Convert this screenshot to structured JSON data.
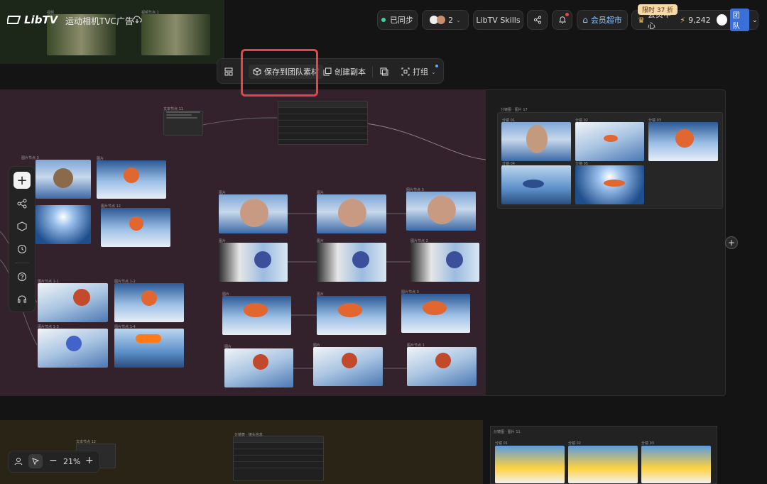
{
  "header": {
    "logo_text": "LibTV",
    "project_title": "运动相机TVC广告",
    "sync_status": "已同步",
    "collaborator_count": "2",
    "skills_label": "LibTV Skills",
    "member_market_label": "会员超市",
    "promo_badge": "限时 37 折",
    "member_center_label": "会员中心",
    "credits": "9,242",
    "team_label": "团队"
  },
  "toolbar": {
    "save_to_team_label": "保存到团队素材",
    "duplicate_label": "创建副本",
    "group_label": "打组"
  },
  "canvas": {
    "top_labels": [
      "视频",
      "视频节点 1"
    ],
    "right_panel_title": "分镜图 · 图片 17",
    "right_panel_items": [
      "分镜 01",
      "分镜 02",
      "分镜 03",
      "分镜 04",
      "分镜 05"
    ],
    "left_labels": [
      "图片节点 3",
      "图片",
      "图片节点 12",
      "图片节点 1-1",
      "图片节点 1-2",
      "图片节点 1-3",
      "图片节点 1-4"
    ],
    "grid_labels": [
      "图片",
      "图片",
      "图片节点 3",
      "图片",
      "图片",
      "图片节点 2",
      "图片",
      "图片",
      "图片节点 3",
      "图片",
      "图片",
      "图片节点 1"
    ],
    "text_node_label": "文本节点 11",
    "bottom_text_node_label": "文本节点 12",
    "bottom_table_title": "分镜表 · 镜头信息",
    "bottom_panel_title": "分镜图 · 图片 11",
    "bottom_panel_items": [
      "分镜 01",
      "分镜 02",
      "分镜 03"
    ]
  },
  "zoom": {
    "level": "21%"
  },
  "colors": {
    "highlight": "#e64545",
    "accent_green": "#3ad29f",
    "member_blue": "#8ec5ff",
    "gold": "#f0c060"
  }
}
